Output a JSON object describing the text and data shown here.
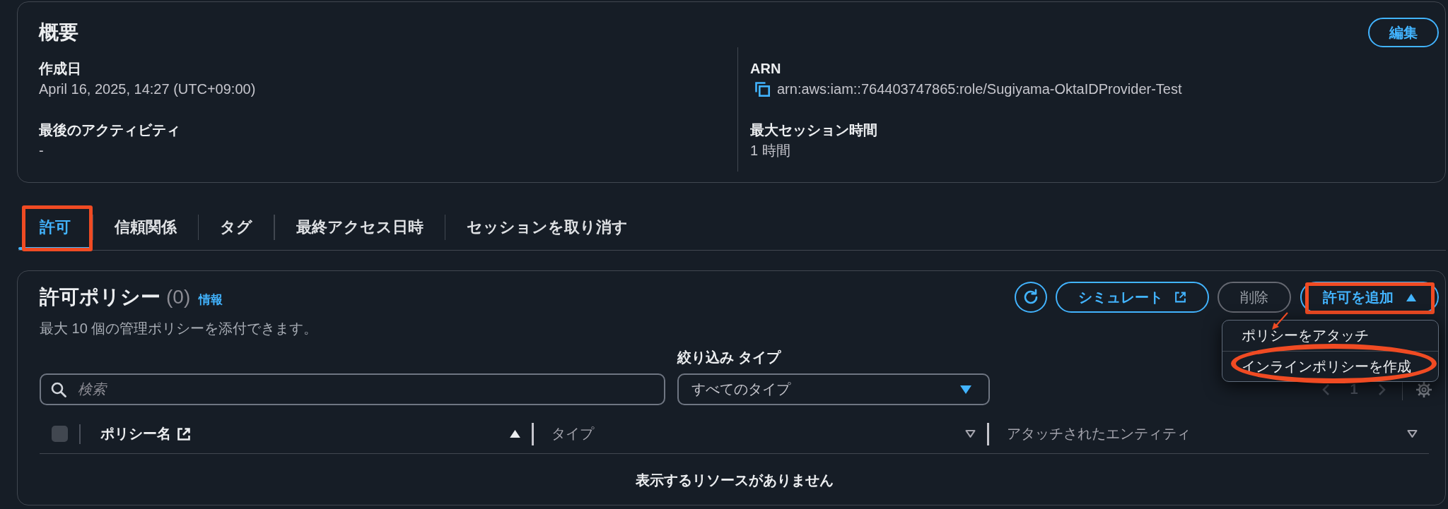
{
  "summary": {
    "title": "概要",
    "edit_button": {
      "label": "編集"
    },
    "columns": [
      {
        "fields": [
          {
            "kind": "text",
            "label": "作成日",
            "value": "April 16, 2025, 14:27 (UTC+09:00)"
          },
          {
            "kind": "text",
            "label": "最後のアクティビティ",
            "value": "-"
          }
        ]
      },
      {
        "fields": [
          {
            "kind": "copyable",
            "label": "ARN",
            "value": "arn:aws:iam::764403747865:role/Sugiyama-OktaIDProvider-Test"
          },
          {
            "kind": "text",
            "label": "最大セッション時間",
            "value": "1 時間"
          }
        ]
      }
    ]
  },
  "tabs": [
    {
      "label": "許可",
      "selected": true,
      "highlighted": true
    },
    {
      "label": "信頼関係",
      "selected": false,
      "highlighted": false
    },
    {
      "label": "タグ",
      "selected": false,
      "highlighted": false
    },
    {
      "label": "最終アクセス日時",
      "selected": false,
      "highlighted": false
    },
    {
      "label": "セッションを取り消す",
      "selected": false,
      "highlighted": false
    }
  ],
  "permissions": {
    "title": "許可ポリシー",
    "count": "(0)",
    "info_link": "情報",
    "description": "最大 10 個の管理ポリシーを添付できます。",
    "actions": [
      {
        "kind": "refresh",
        "disabled": false
      },
      {
        "kind": "simulate",
        "label": "シミュレート",
        "disabled": false
      },
      {
        "kind": "delete",
        "label": "削除",
        "disabled": true
      },
      {
        "kind": "add",
        "label": "許可を追加",
        "disabled": false,
        "expanded": true,
        "highlighted": true,
        "menu": [
          {
            "label": "ポリシーをアタッチ",
            "pointed_at": true,
            "circled": false
          },
          {
            "label": "インラインポリシーを作成",
            "pointed_at": false,
            "circled": true
          }
        ]
      }
    ],
    "search": {
      "placeholder": "検索"
    },
    "filter": {
      "label": "絞り込み タイプ",
      "value": "すべてのタイプ"
    },
    "pagination": {
      "page": "1"
    },
    "table": {
      "select_all": {
        "checked": false,
        "disabled": true
      },
      "columns": [
        {
          "label": "ポリシー名",
          "sorted": true,
          "external_link": true
        },
        {
          "label": "タイプ",
          "sorted": false,
          "external_link": false
        },
        {
          "label": "アタッチされたエンティティ",
          "sorted": false,
          "external_link": false
        }
      ],
      "empty_message": "表示するリソースがありません"
    }
  }
}
